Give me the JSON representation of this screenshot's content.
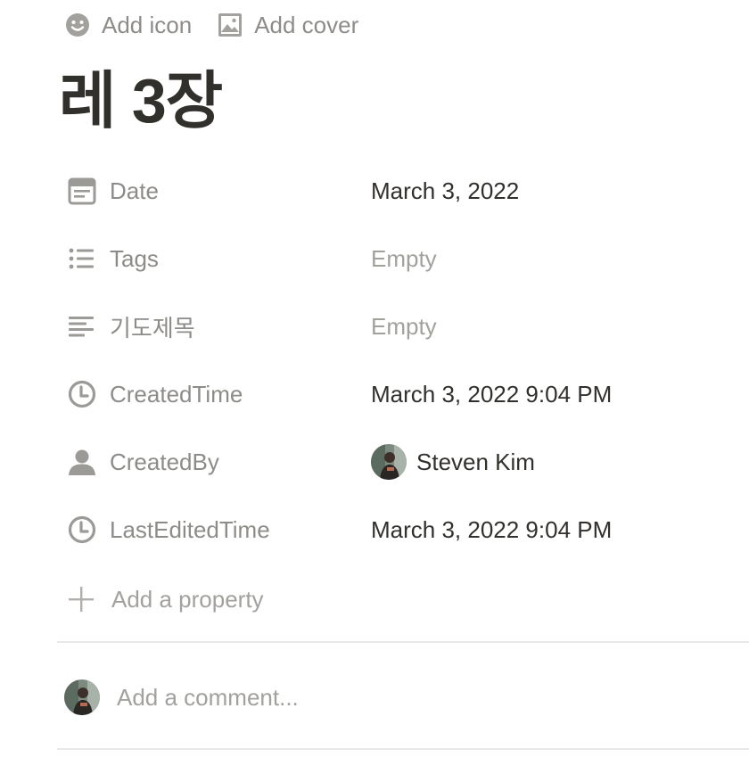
{
  "page_actions": {
    "add_icon_label": "Add icon",
    "add_cover_label": "Add cover"
  },
  "page_title": "레 3장",
  "properties": [
    {
      "name": "Date",
      "icon": "calendar-icon",
      "value": "March 3, 2022",
      "empty": false
    },
    {
      "name": "Tags",
      "icon": "list-icon",
      "value": "Empty",
      "empty": true
    },
    {
      "name": "기도제목",
      "icon": "text-lines-icon",
      "value": "Empty",
      "empty": true
    },
    {
      "name": "CreatedTime",
      "icon": "clock-icon",
      "value": "March 3, 2022 9:04 PM",
      "empty": false
    },
    {
      "name": "CreatedBy",
      "icon": "person-icon",
      "value": "Steven Kim",
      "empty": false,
      "avatar": true
    },
    {
      "name": "LastEditedTime",
      "icon": "clock-icon",
      "value": "March 3, 2022 9:04 PM",
      "empty": false
    }
  ],
  "add_property_label": "Add a property",
  "comment": {
    "placeholder": "Add a comment..."
  },
  "colors": {
    "text": "#37352f",
    "muted": "#8e8c88",
    "placeholder": "#a3a19d",
    "divider": "#ebeae8"
  }
}
